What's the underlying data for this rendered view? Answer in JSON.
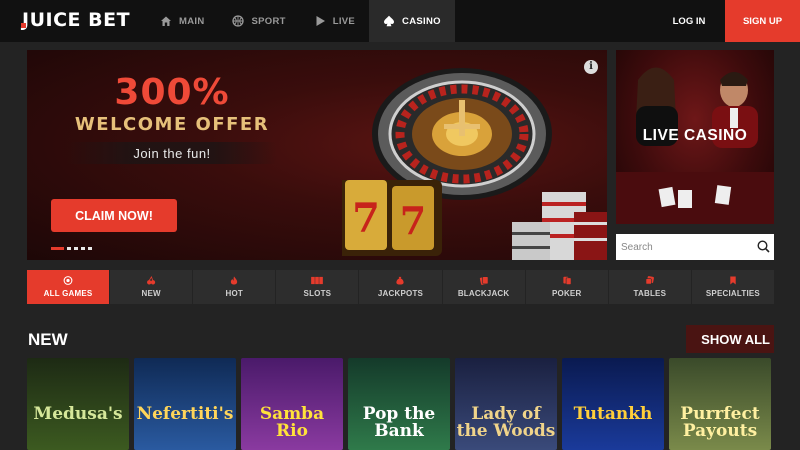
{
  "brand": {
    "name": "JUICE BET",
    "accent": "#e53b2c"
  },
  "nav": [
    {
      "label": "MAIN",
      "icon": "home-icon",
      "active": false
    },
    {
      "label": "SPORT",
      "icon": "basketball-icon",
      "active": false
    },
    {
      "label": "LIVE",
      "icon": "play-icon",
      "active": false
    },
    {
      "label": "CASINO",
      "icon": "spade-icon",
      "active": true
    }
  ],
  "auth": {
    "login": "LOG IN",
    "signup": "SIGN UP"
  },
  "hero": {
    "percent": "300%",
    "title": "WELCOME OFFER",
    "subtitle": "Join the fun!",
    "cta": "CLAIM NOW!",
    "slot_digits": [
      "7",
      "7",
      "7"
    ],
    "info_icon": "info-icon"
  },
  "live": {
    "title": "LIVE CASINO"
  },
  "search": {
    "placeholder": "Search",
    "icon": "search-icon"
  },
  "categories": [
    {
      "label": "ALL GAMES",
      "icon": "chip-icon",
      "active": true
    },
    {
      "label": "NEW",
      "icon": "cherry-icon"
    },
    {
      "label": "HOT",
      "icon": "flame-icon"
    },
    {
      "label": "SLOTS",
      "icon": "slots-icon"
    },
    {
      "label": "JACKPOTS",
      "icon": "money-bag-icon"
    },
    {
      "label": "BLACKJACK",
      "icon": "cards-icon"
    },
    {
      "label": "POKER",
      "icon": "poker-cards-icon"
    },
    {
      "label": "TABLES",
      "icon": "dice-icon"
    },
    {
      "label": "SPECIALTIES",
      "icon": "bookmark-icon"
    }
  ],
  "new_section": {
    "title": "NEW",
    "show_all": "SHOW ALL",
    "games": [
      {
        "title": "Medusa's",
        "color": "#2f4a1c"
      },
      {
        "title": "Nefertiti's",
        "color": "#1b3f6b"
      },
      {
        "title": "Samba Rio",
        "color": "#6b2a7a"
      },
      {
        "title": "Pop the Bank",
        "color": "#1f5a3a"
      },
      {
        "title": "Lady of the Woods",
        "color": "#2a3358"
      },
      {
        "title": "Tutankh",
        "color": "#152a6a"
      },
      {
        "title": "Purrfect Payouts",
        "color": "#5a6b3a"
      }
    ]
  }
}
